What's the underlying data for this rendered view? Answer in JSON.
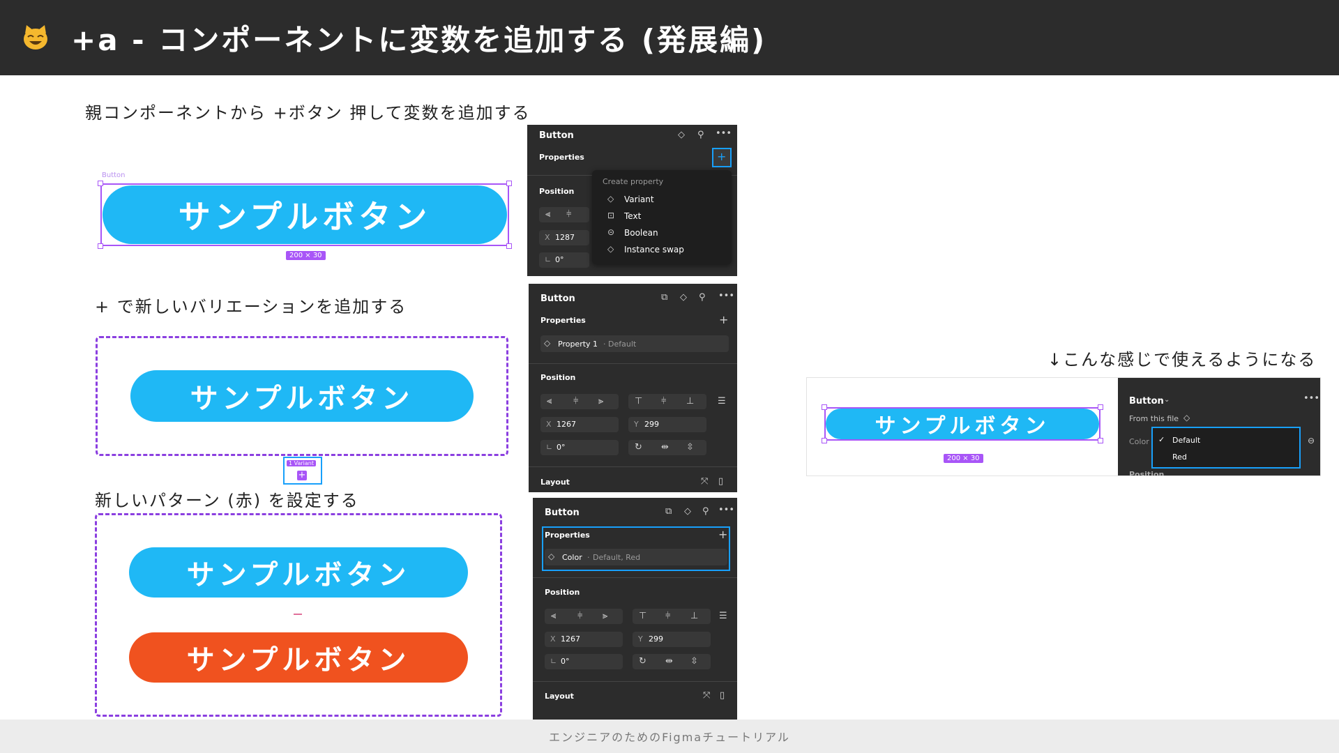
{
  "header": {
    "title": "+a - コンポーネントに変数を追加する (発展編)",
    "icon": "cat-face-icon"
  },
  "captions": {
    "c1": "親コンポーネントから +ボタン 押して変数を追加する",
    "c2": "+ で新しいバリエーションを追加する",
    "c3": "新しいパターン (赤) を設定する",
    "c4": "↓こんな感じで使えるようになる"
  },
  "sample_button_label": "サンプルボタン",
  "component_label": "Button",
  "dimension_badge": "200 × 30",
  "variant_badge": "1 Variant",
  "panel1": {
    "title": "Button",
    "properties": "Properties",
    "position": "Position",
    "x_label": "X",
    "x_value": "1287",
    "rot_value": "0°",
    "menu": {
      "header": "Create property",
      "items": [
        "Variant",
        "Text",
        "Boolean",
        "Instance swap"
      ]
    }
  },
  "panel2": {
    "title": "Button",
    "properties": "Properties",
    "property_row": "Property 1",
    "property_value": "Default",
    "position": "Position",
    "x_label": "X",
    "x_value": "1267",
    "y_label": "Y",
    "y_value": "299",
    "rot_value": "0°",
    "layout": "Layout"
  },
  "panel3": {
    "title": "Button",
    "properties": "Properties",
    "property_row": "Color",
    "property_value": "Default, Red",
    "position": "Position",
    "x_label": "X",
    "x_value": "1267",
    "y_label": "Y",
    "y_value": "299",
    "rot_value": "0°",
    "layout": "Layout"
  },
  "panel4": {
    "title": "Button",
    "from_file": "From this file",
    "color_label": "Color",
    "options": [
      "Default",
      "Red"
    ],
    "position_partial": "Position"
  },
  "footer": "エンジニアのためのFigmaチュートリアル",
  "colors": {
    "blue": "#1fb8f5",
    "red": "#f0521f",
    "selection": "#a855f7",
    "highlight": "#18a0fb",
    "panel": "#2c2c2c"
  }
}
